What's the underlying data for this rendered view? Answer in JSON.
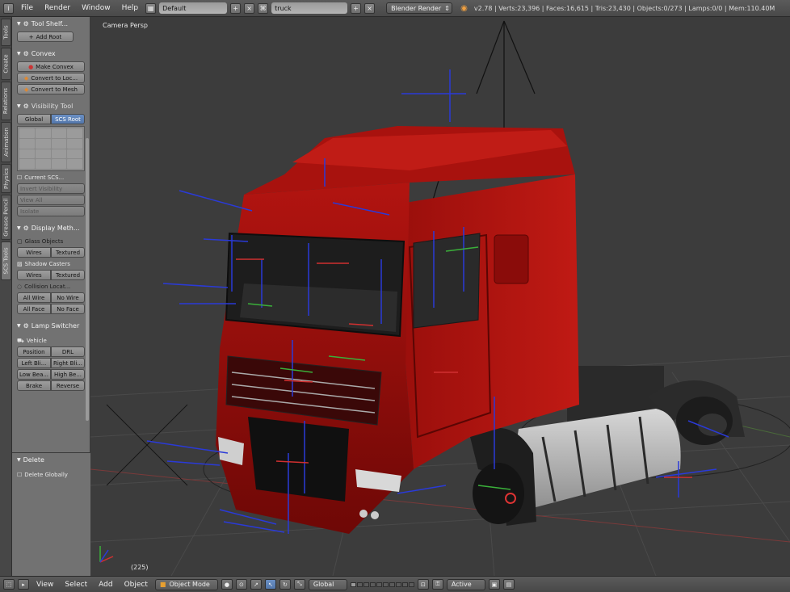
{
  "topbar": {
    "menus": [
      "File",
      "Render",
      "Window",
      "Help"
    ],
    "screen_layout": "Default",
    "scene": "truck",
    "render_engine": "Blender Render",
    "stats": "v2.78 | Verts:23,396 | Faces:16,615 | Tris:23,430 | Objects:0/273 | Lamps:0/0 | Mem:110.40M"
  },
  "vertical_tabs": [
    "Tools",
    "Create",
    "Relations",
    "Animation",
    "Physics",
    "Grease Pencil",
    "SCS Tools"
  ],
  "shelf": {
    "tool_shelf": {
      "title": "Tool Shelf...",
      "add_root": "Add Root"
    },
    "convex": {
      "title": "Convex",
      "make_convex": "Make Convex",
      "convert_to_loc": "Convert to Loc...",
      "convert_to_mesh": "Convert to Mesh"
    },
    "visibility": {
      "title": "Visibility Tool",
      "global": "Global",
      "scs_root": "SCS Root",
      "current_scs": "Current SCS...",
      "invert_visibility": "Invert Visibility",
      "view_all": "View All",
      "isolate": "Isolate"
    },
    "display": {
      "title": "Display Meth...",
      "glass_objects": "Glass Objects",
      "shadow_casters": "Shadow Casters",
      "collision_locators": "Collision Locat...",
      "wires": "Wires",
      "textured": "Textured",
      "all_wire": "All Wire",
      "no_wire": "No Wire",
      "all_face": "All Face",
      "no_face": "No Face"
    },
    "lamp": {
      "title": "Lamp Switcher",
      "vehicle": "Vehicle",
      "position": "Position",
      "drl": "DRL",
      "left_blinker": "Left Bli...",
      "right_blinker": "Right Bli...",
      "low_beam": "Low Bea...",
      "high_beam": "High Be...",
      "brake": "Brake",
      "reverse": "Reverse"
    }
  },
  "lower_panel": {
    "title": "Delete",
    "delete_globally": "Delete Globally"
  },
  "viewport": {
    "label": "Camera Persp",
    "frame": "(225)"
  },
  "bottombar": {
    "menus": [
      "View",
      "Select",
      "Add",
      "Object"
    ],
    "mode": "Object Mode",
    "orientation": "Global",
    "keying": "Active"
  }
}
